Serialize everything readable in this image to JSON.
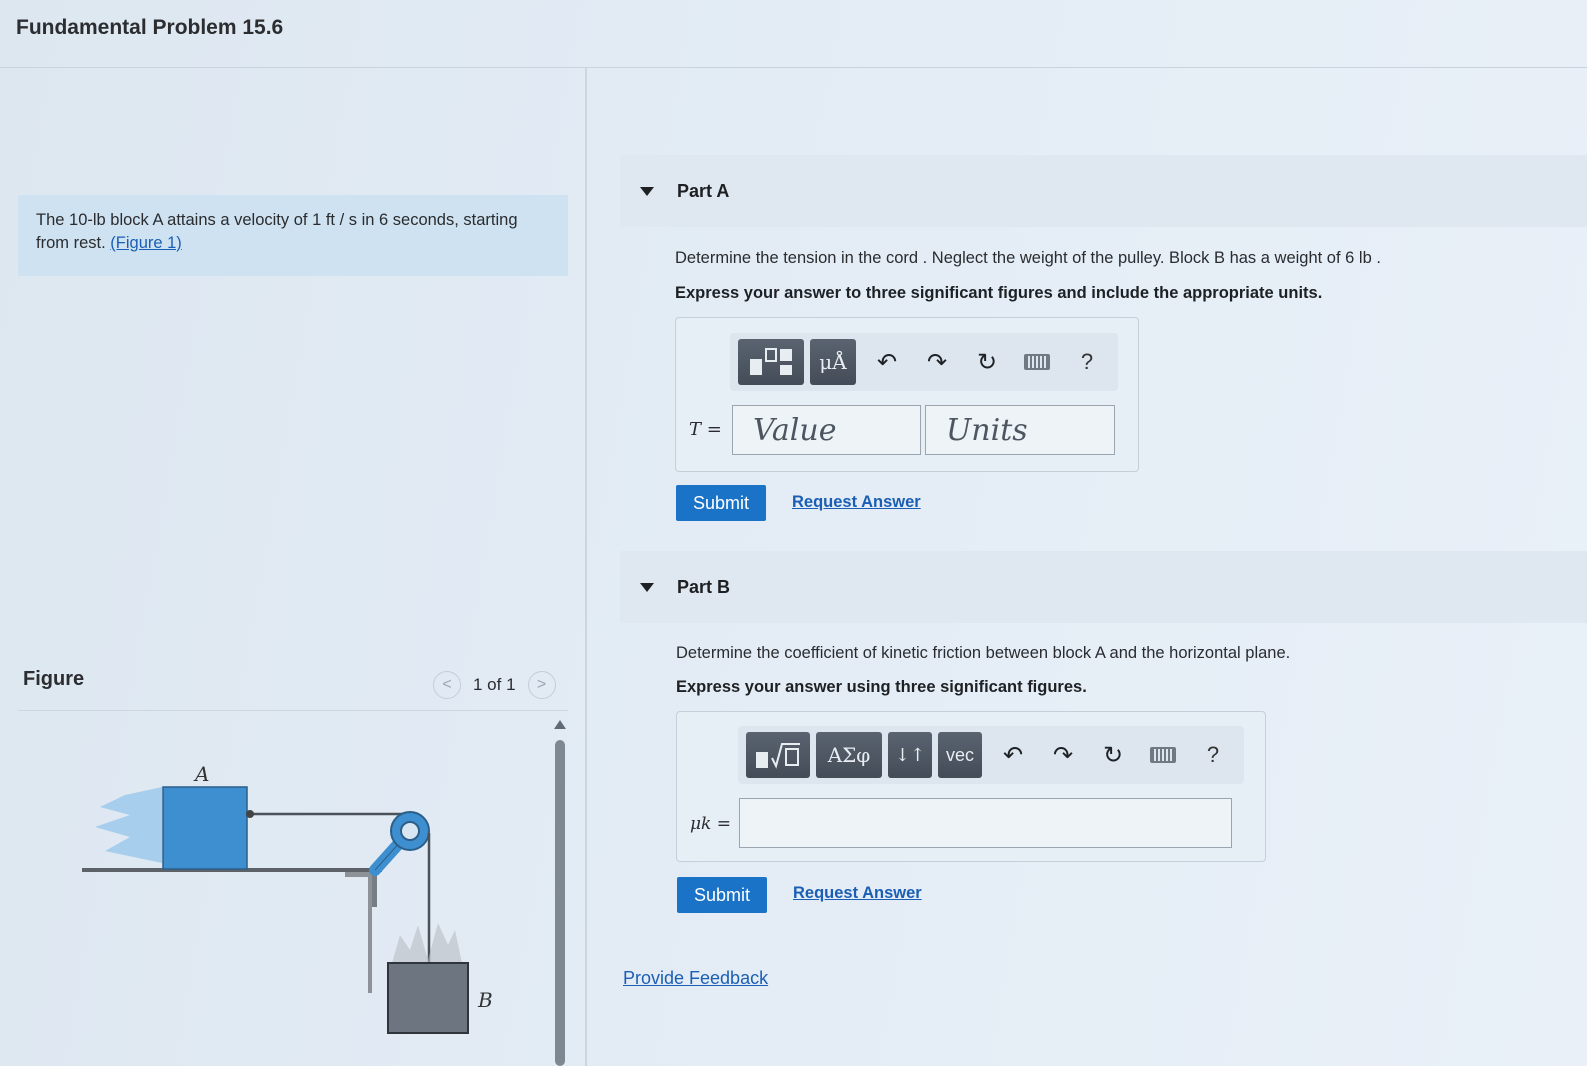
{
  "header": {
    "title": "Fundamental Problem 15.6"
  },
  "problem": {
    "text": "The 10-lb block A attains a velocity of 1 ft / s in 6 seconds, starting from rest.",
    "figure_link": "(Figure 1)"
  },
  "figure": {
    "label": "Figure",
    "pager": "1 of 1",
    "prev": "<",
    "next": ">",
    "block_a_label": "A",
    "block_b_label": "B"
  },
  "part_a": {
    "title": "Part A",
    "question": "Determine the tension in the cord . Neglect the weight of the pulley. Block B has a weight of 6 lb .",
    "instruction": "Express your answer to three significant figures and include the appropriate units.",
    "variable": "T =",
    "value_placeholder": "Value",
    "units_placeholder": "Units",
    "tool_templates_icon": "templates-icon",
    "tool_units_text": "μÅ",
    "help": "?",
    "submit": "Submit",
    "request": "Request Answer"
  },
  "part_b": {
    "title": "Part B",
    "question": "Determine the coefficient of kinetic friction between block A and the horizontal plane.",
    "instruction": "Express your answer using three significant figures.",
    "variable": "μk =",
    "tool_greek": "ΑΣφ",
    "tool_arrows": "↓↑",
    "tool_vec": "vec",
    "help": "?",
    "submit": "Submit",
    "request": "Request Answer"
  },
  "feedback": "Provide Feedback",
  "colors": {
    "accent": "#1a73c7",
    "link": "#1a5fb4",
    "block": "#3d8fd0"
  }
}
